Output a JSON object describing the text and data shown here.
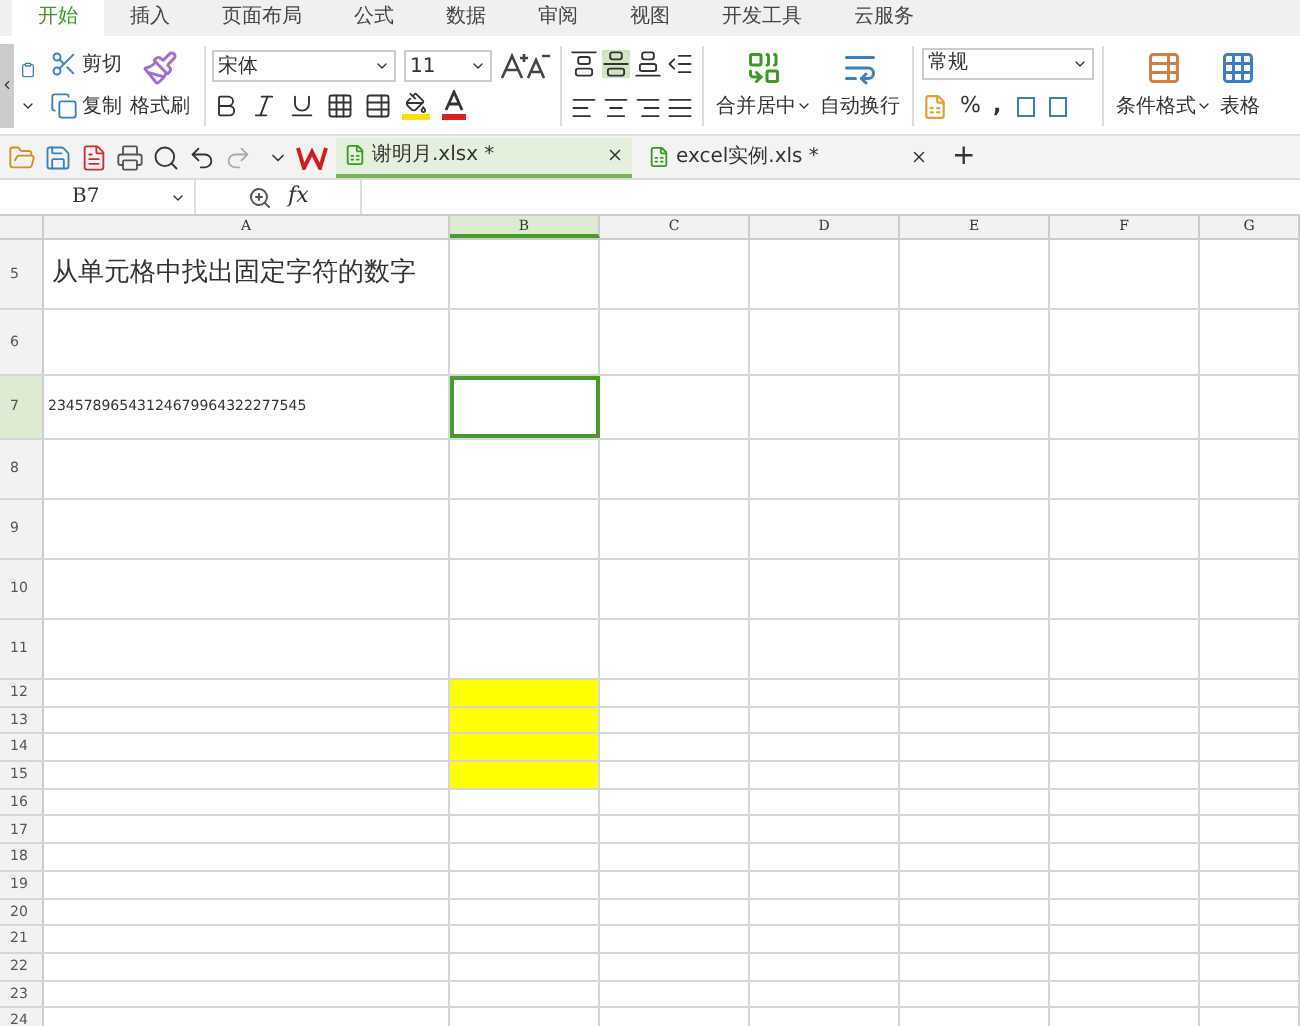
{
  "menu_tabs": [
    {
      "label": "开始",
      "selected": true
    },
    {
      "label": "插入",
      "selected": false
    },
    {
      "label": "页面布局",
      "selected": false
    },
    {
      "label": "公式",
      "selected": false
    },
    {
      "label": "数据",
      "selected": false
    },
    {
      "label": "审阅",
      "selected": false
    },
    {
      "label": "视图",
      "selected": false
    },
    {
      "label": "开发工具",
      "selected": false
    },
    {
      "label": "云服务",
      "selected": false
    }
  ],
  "clipboard": {
    "cut": "剪切",
    "copy": "复制",
    "format_painter": "格式刷"
  },
  "font": {
    "name": "宋体",
    "size": "11"
  },
  "merge": {
    "merge_center": "合并居中",
    "wrap_text": "自动换行"
  },
  "number": {
    "format": "常规",
    "percent": "%",
    "comma": ","
  },
  "styles": {
    "conditional_format": "条件格式",
    "table": "表格"
  },
  "doc_tabs": [
    {
      "title": "谢明月.xlsx *",
      "selected": true
    },
    {
      "title": "excel实例.xls *",
      "selected": false
    }
  ],
  "add_tab": "+",
  "formula_bar": {
    "name_box": "B7",
    "fx": "fx"
  },
  "columns": [
    "A",
    "B",
    "C",
    "D",
    "E",
    "F",
    "G"
  ],
  "rows": [
    {
      "number": "5",
      "cells": [
        {
          "text": "从单元格中找出固定字符的数字",
          "selected": false
        },
        {
          "selected": false
        },
        {
          "selected": false
        },
        {
          "selected": false
        },
        {
          "selected": false
        },
        {
          "selected": false
        },
        {
          "selected": false
        }
      ]
    },
    {
      "number": "6"
    },
    {
      "number": "7",
      "cells": [
        {
          "text": "23457896543124679964322277545",
          "selected": false
        },
        {
          "selected": true
        },
        {
          "selected": false
        },
        {
          "selected": false
        },
        {
          "selected": false
        },
        {
          "selected": false
        },
        {
          "selected": false
        }
      ]
    },
    {
      "number": "8"
    },
    {
      "number": "9"
    },
    {
      "number": "10"
    },
    {
      "number": "11"
    },
    {
      "number": "12",
      "cells": [
        {
          "selected": false
        },
        {
          "color": "#ffff00",
          "selected": false
        },
        {
          "selected": false
        },
        {
          "selected": false
        },
        {
          "selected": false
        },
        {
          "selected": false
        },
        {
          "selected": false
        }
      ]
    },
    {
      "number": "13",
      "cells": [
        {
          "selected": false
        },
        {
          "color": "#ffff00",
          "selected": false
        },
        {
          "selected": false
        },
        {
          "selected": false
        },
        {
          "selected": false
        },
        {
          "selected": false
        },
        {
          "selected": false
        }
      ]
    },
    {
      "number": "14",
      "cells": [
        {
          "selected": false
        },
        {
          "color": "#ffff00",
          "selected": false
        },
        {
          "selected": false
        },
        {
          "selected": false
        },
        {
          "selected": false
        },
        {
          "selected": false
        },
        {
          "selected": false
        }
      ]
    },
    {
      "number": "15",
      "cells": [
        {
          "selected": false
        },
        {
          "color": "#ffff00",
          "selected": false
        },
        {
          "selected": false
        },
        {
          "selected": false
        },
        {
          "selected": false
        },
        {
          "selected": false
        },
        {
          "selected": false
        }
      ]
    },
    {
      "number": "16"
    },
    {
      "number": "17"
    },
    {
      "number": "18"
    },
    {
      "number": "19"
    },
    {
      "number": "20"
    },
    {
      "number": "21"
    },
    {
      "number": "22"
    },
    {
      "number": "23"
    },
    {
      "number": "24"
    }
  ]
}
